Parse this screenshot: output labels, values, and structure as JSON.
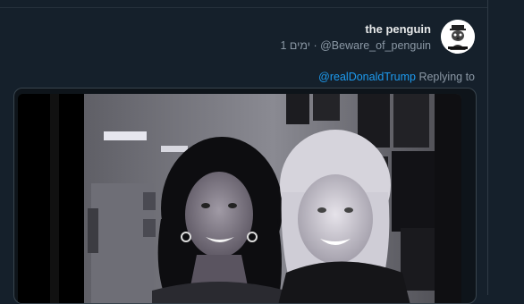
{
  "tweet": {
    "display_name": "the penguin",
    "handle": "@Beware_of_penguin",
    "time_ago": "1 ימים",
    "separator": "·",
    "reply_mention": "@realDonaldTrump",
    "reply_label": "Replying to"
  },
  "colors": {
    "background": "#15202b",
    "link": "#1d9bf0",
    "secondary_text": "#8b98a5",
    "primary_text": "#e7e9ea"
  },
  "media": {
    "type": "black-and-white photo of two smiling women posing together"
  },
  "avatar": {
    "icon": "penguin-avatar-icon"
  }
}
